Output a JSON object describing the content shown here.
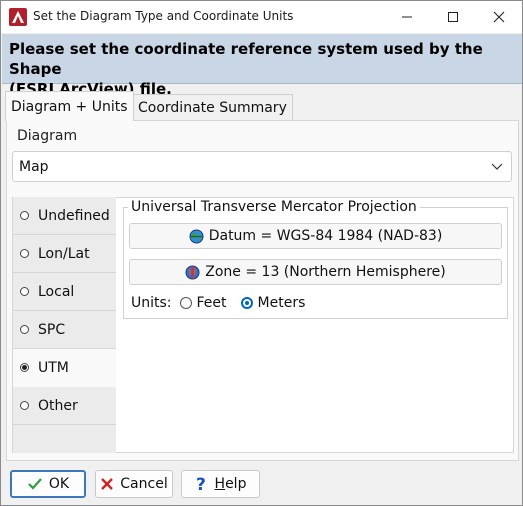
{
  "window": {
    "title": "Set the Diagram Type and Coordinate Units"
  },
  "banner": {
    "line1": "Please set the coordinate reference system used by the Shape",
    "line2": "(ESRI ArcView) file."
  },
  "tabs": [
    {
      "label": "Diagram + Units",
      "active": true
    },
    {
      "label": "Coordinate Summary",
      "active": false
    }
  ],
  "diagram": {
    "label": "Diagram",
    "selected": "Map"
  },
  "coordinate_types": [
    {
      "label": "Undefined",
      "selected": false
    },
    {
      "label": "Lon/Lat",
      "selected": false
    },
    {
      "label": "Local",
      "selected": false
    },
    {
      "label": "SPC",
      "selected": false
    },
    {
      "label": "UTM",
      "selected": true
    },
    {
      "label": "Other",
      "selected": false
    }
  ],
  "utm": {
    "title": "Universal Transverse Mercator Projection",
    "datum_label": "Datum = WGS-84 1984 (NAD-83)",
    "zone_label": "Zone = 13 (Northern Hemisphere)",
    "units_label": "Units:",
    "unit_options": [
      {
        "label": "Feet",
        "selected": false
      },
      {
        "label": "Meters",
        "selected": true
      }
    ]
  },
  "buttons": {
    "ok": "OK",
    "cancel": "Cancel",
    "help_first": "H",
    "help_rest": "elp"
  },
  "colors": {
    "banner_bg": "#c8d6e5",
    "accent": "#0067c0",
    "ok_check": "#2e9e3e",
    "cancel_x": "#d02020",
    "help_q": "#1a4fc4"
  }
}
